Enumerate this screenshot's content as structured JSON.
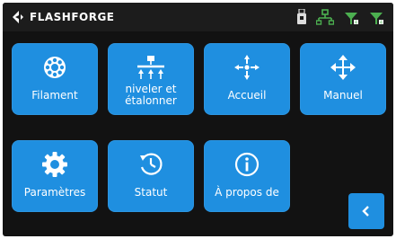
{
  "header": {
    "brand": "FLASHFORGE",
    "icons": [
      "usb-drive-icon",
      "network-connected-icon",
      "wifi-signal-icon",
      "wifi-signal-icon"
    ]
  },
  "tiles": [
    {
      "label": "Filament",
      "icon": "filament-spool-icon"
    },
    {
      "label": "niveler et étalonner",
      "icon": "leveling-icon"
    },
    {
      "label": "Accueil",
      "icon": "home-axes-icon"
    },
    {
      "label": "Manuel",
      "icon": "move-arrows-icon"
    },
    {
      "label": "Paramètres",
      "icon": "gear-icon"
    },
    {
      "label": "Statut",
      "icon": "clock-icon"
    },
    {
      "label": "À propos de",
      "icon": "info-icon"
    }
  ],
  "back_button": {
    "icon": "chevron-left-icon"
  },
  "colors": {
    "tile": "#1f8fe0",
    "background": "#121212",
    "status_green": "#4caf50"
  }
}
